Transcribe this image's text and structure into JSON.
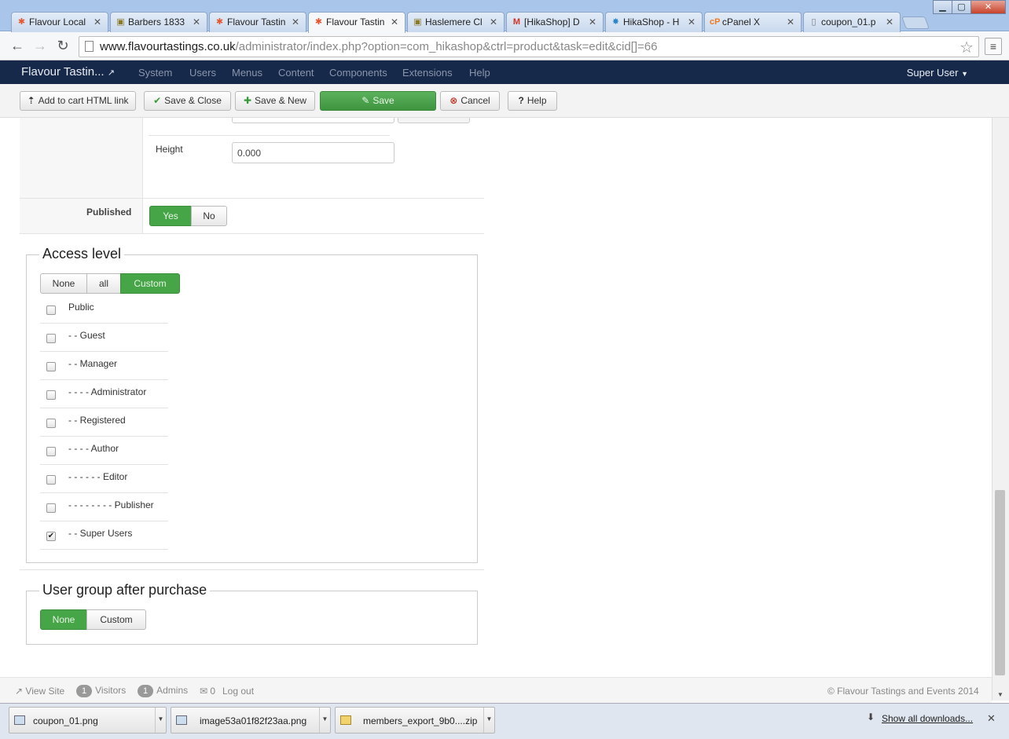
{
  "browser": {
    "tabs": [
      {
        "title": "Flavour Local",
        "icon": "joomla-icon",
        "active": false
      },
      {
        "title": "Barbers 1833",
        "icon": "shop-icon",
        "active": false
      },
      {
        "title": "Flavour Tastin",
        "icon": "joomla-icon",
        "active": false
      },
      {
        "title": "Flavour Tastin",
        "icon": "joomla-icon",
        "active": true
      },
      {
        "title": "Haslemere Cl",
        "icon": "shop-icon",
        "active": false
      },
      {
        "title": "[HikaShop] D",
        "icon": "gmail-icon",
        "active": false
      },
      {
        "title": "HikaShop - H",
        "icon": "hikashop-icon",
        "active": false
      },
      {
        "title": "cPanel X",
        "icon": "cpanel-icon",
        "active": false
      },
      {
        "title": "coupon_01.p",
        "icon": "page-icon",
        "active": false
      }
    ],
    "url_host": "www.flavourtastings.co.uk",
    "url_path": "/administrator/index.php?option=com_hikashop&ctrl=product&task=edit&cid[]=66"
  },
  "adminbar": {
    "brand": "Flavour Tastin...",
    "menu": [
      "System",
      "Users",
      "Menus",
      "Content",
      "Components",
      "Extensions",
      "Help"
    ],
    "user": "Super User"
  },
  "toolbar": {
    "add_to_cart": "Add to cart HTML link",
    "save_close": "Save & Close",
    "save_new": "Save & New",
    "save": "Save",
    "cancel": "Cancel",
    "help": "Help"
  },
  "form": {
    "height_label": "Height",
    "height_value": "0.000",
    "published_label": "Published",
    "published_yes": "Yes",
    "published_no": "No",
    "published_value": "Yes"
  },
  "access": {
    "legend": "Access level",
    "modes": [
      "None",
      "all",
      "Custom"
    ],
    "selected_mode": "Custom",
    "groups": [
      {
        "label": "Public",
        "checked": false
      },
      {
        "label": "- - Guest",
        "checked": false
      },
      {
        "label": "- - Manager",
        "checked": false
      },
      {
        "label": "- - - - Administrator",
        "checked": false
      },
      {
        "label": "- - Registered",
        "checked": false
      },
      {
        "label": "- - - - Author",
        "checked": false
      },
      {
        "label": "- - - - - - Editor",
        "checked": false
      },
      {
        "label": "- - - - - - - - Publisher",
        "checked": false
      },
      {
        "label": "- - Super Users",
        "checked": true
      }
    ]
  },
  "after_purchase": {
    "legend": "User group after purchase",
    "modes": [
      "None",
      "Custom"
    ],
    "selected_mode": "None"
  },
  "statusbar": {
    "view_site": "View Site",
    "visitors_count": "1",
    "visitors": "Visitors",
    "admins_count": "1",
    "admins": "Admins",
    "messages_count": "0",
    "logout": "Log out",
    "copyright": "© Flavour Tastings and Events 2014"
  },
  "downloads": {
    "items": [
      "coupon_01.png",
      "image53a01f82f23aa.png",
      "members_export_9b0....zip"
    ],
    "show_all": "Show all downloads..."
  }
}
